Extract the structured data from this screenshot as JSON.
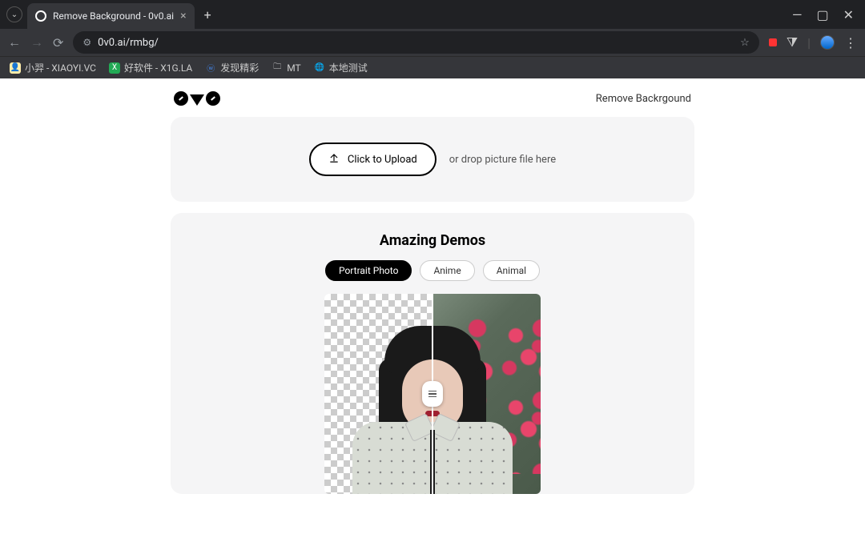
{
  "browser": {
    "tab_title": "Remove Background - 0v0.ai",
    "url": "0v0.ai/rmbg/"
  },
  "bookmarks": [
    {
      "label": "小羿 - XIAOYI.VC"
    },
    {
      "label": "好软件 - X1G.LA"
    },
    {
      "label": "发现精彩"
    },
    {
      "label": "MT"
    },
    {
      "label": "本地测试"
    }
  ],
  "header": {
    "nav_link": "Remove Backrgound"
  },
  "upload": {
    "button_label": "Click to Upload",
    "drop_text": "or drop picture file here"
  },
  "demos": {
    "title": "Amazing Demos",
    "tabs": [
      "Portrait Photo",
      "Anime",
      "Animal"
    ],
    "active_tab": 0
  }
}
